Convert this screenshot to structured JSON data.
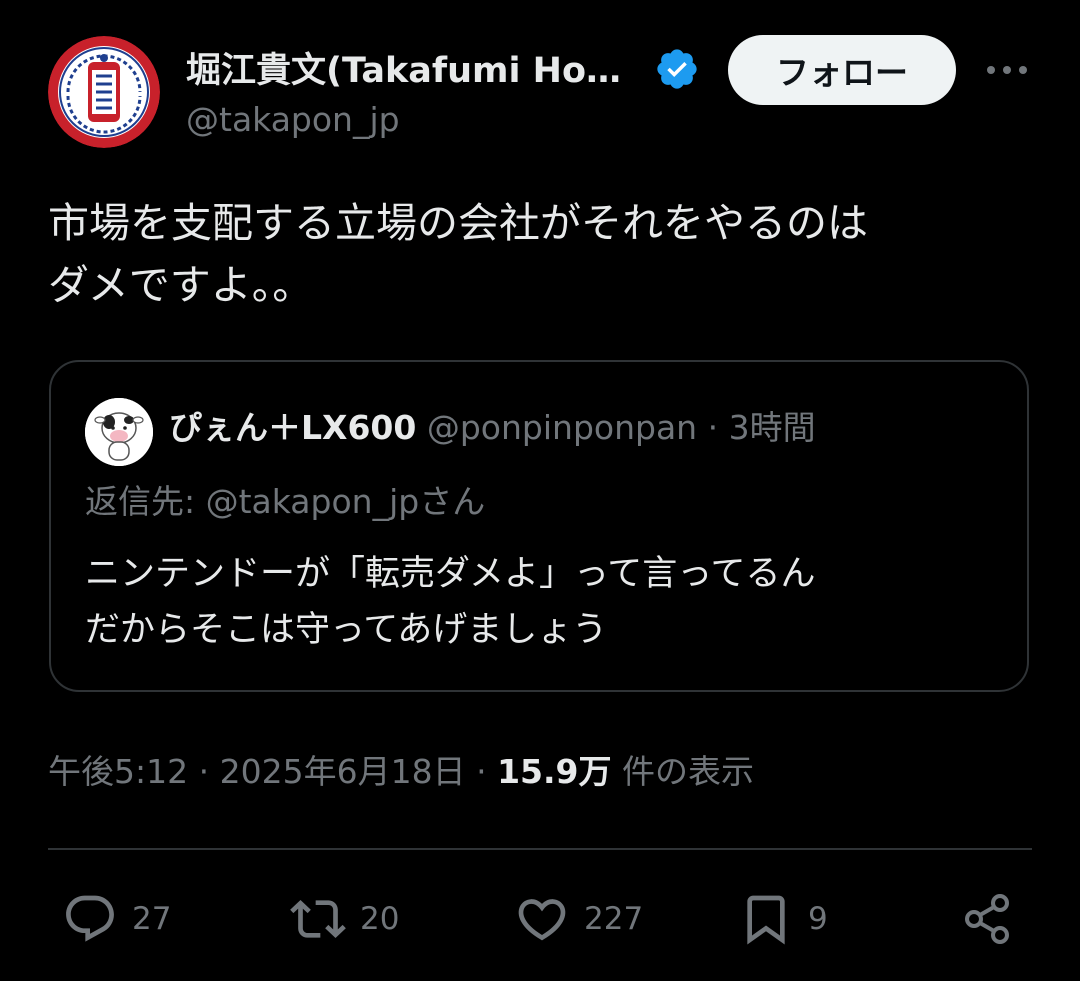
{
  "author": {
    "display_name": "堀江貴文(Takafumi Ho…",
    "handle": "@takapon_jp",
    "avatar_icon": "onsen-festival-logo-icon",
    "verified": true
  },
  "follow_label": "フォロー",
  "tweet": {
    "text_line1": "市場を支配する立場の会社がそれをやるのは",
    "text_line2": "ダメですよ。。"
  },
  "quote": {
    "display_name": "ぴぇん＋LX600",
    "handle": "@ponpinponpan",
    "separator": "·",
    "time": "3時間",
    "reply_to": "返信先: @takapon_jpさん",
    "text_line1": "ニンテンドーが「転売ダメよ」って言ってるん",
    "text_line2": "だからそこは守ってあげましょう"
  },
  "meta": {
    "time": "午後5:12",
    "separator": "·",
    "date": "2025年6月18日",
    "views_count": "15.9万",
    "views_label": "件の表示"
  },
  "actions": {
    "replies": "27",
    "reposts": "20",
    "likes": "227",
    "bookmarks": "9"
  },
  "colors": {
    "background": "#000000",
    "text_primary": "#e7e9ea",
    "text_secondary": "#71767b",
    "border": "#2f3336",
    "verified_blue": "#1d9bf0",
    "follow_bg": "#eff3f4"
  }
}
